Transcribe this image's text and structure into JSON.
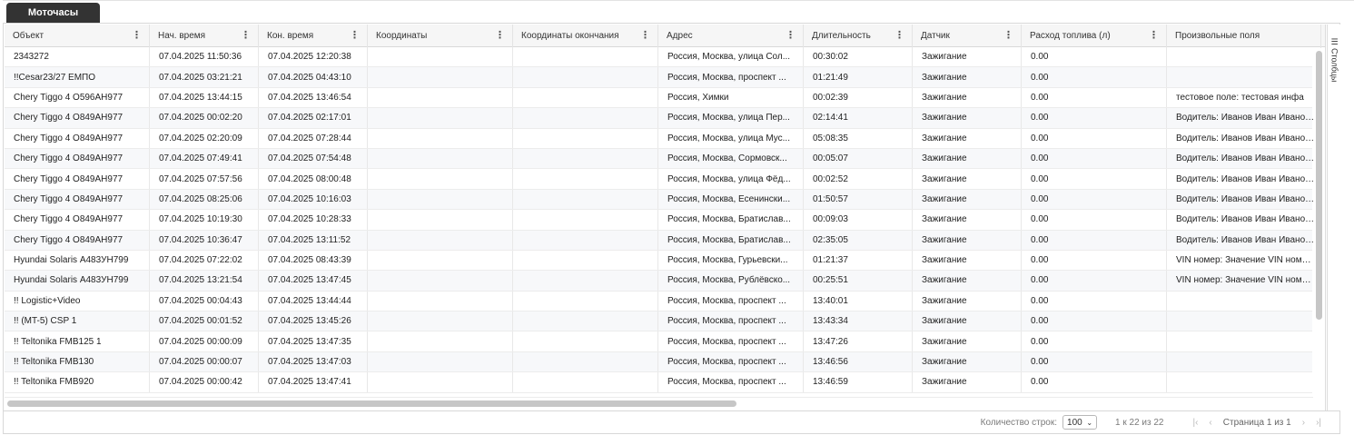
{
  "tab": {
    "label": "Моточасы"
  },
  "columns": [
    {
      "label": "Объект",
      "menu": true
    },
    {
      "label": "Нач. время",
      "menu": true
    },
    {
      "label": "Кон. время",
      "menu": true
    },
    {
      "label": "Координаты",
      "menu": true
    },
    {
      "label": "Координаты окончания",
      "menu": true
    },
    {
      "label": "Адрес",
      "menu": true
    },
    {
      "label": "Длительность",
      "menu": true
    },
    {
      "label": "Датчик",
      "menu": true
    },
    {
      "label": "Расход топлива (л)",
      "menu": true
    },
    {
      "label": "Произвольные поля",
      "menu": false
    }
  ],
  "rows": [
    [
      "2343272",
      "07.04.2025 11:50:36",
      "07.04.2025 12:20:38",
      "",
      "",
      "Россия, Москва, улица Сол...",
      "00:30:02",
      "Зажигание",
      "0.00",
      ""
    ],
    [
      "!!Cesar23/27 ЕМПО",
      "07.04.2025 03:21:21",
      "07.04.2025 04:43:10",
      "",
      "",
      "Россия, Москва, проспект ...",
      "01:21:49",
      "Зажигание",
      "0.00",
      ""
    ],
    [
      "Chery Tiggo 4 О596АН977",
      "07.04.2025 13:44:15",
      "07.04.2025 13:46:54",
      "",
      "",
      "Россия, Химки",
      "00:02:39",
      "Зажигание",
      "0.00",
      "тестовое поле: тестовая инфа"
    ],
    [
      "Chery Tiggo 4 О849АН977",
      "07.04.2025 00:02:20",
      "07.04.2025 02:17:01",
      "",
      "",
      "Россия, Москва, улица Пер...",
      "02:14:41",
      "Зажигание",
      "0.00",
      "Водитель: Иванов Иван Иванович"
    ],
    [
      "Chery Tiggo 4 О849АН977",
      "07.04.2025 02:20:09",
      "07.04.2025 07:28:44",
      "",
      "",
      "Россия, Москва, улица Мус...",
      "05:08:35",
      "Зажигание",
      "0.00",
      "Водитель: Иванов Иван Иванович"
    ],
    [
      "Chery Tiggo 4 О849АН977",
      "07.04.2025 07:49:41",
      "07.04.2025 07:54:48",
      "",
      "",
      "Россия, Москва, Сормовск...",
      "00:05:07",
      "Зажигание",
      "0.00",
      "Водитель: Иванов Иван Иванович"
    ],
    [
      "Chery Tiggo 4 О849АН977",
      "07.04.2025 07:57:56",
      "07.04.2025 08:00:48",
      "",
      "",
      "Россия, Москва, улица Фёд...",
      "00:02:52",
      "Зажигание",
      "0.00",
      "Водитель: Иванов Иван Иванович"
    ],
    [
      "Chery Tiggo 4 О849АН977",
      "07.04.2025 08:25:06",
      "07.04.2025 10:16:03",
      "",
      "",
      "Россия, Москва, Есенински...",
      "01:50:57",
      "Зажигание",
      "0.00",
      "Водитель: Иванов Иван Иванович"
    ],
    [
      "Chery Tiggo 4 О849АН977",
      "07.04.2025 10:19:30",
      "07.04.2025 10:28:33",
      "",
      "",
      "Россия, Москва, Братислав...",
      "00:09:03",
      "Зажигание",
      "0.00",
      "Водитель: Иванов Иван Иванович"
    ],
    [
      "Chery Tiggo 4 О849АН977",
      "07.04.2025 10:36:47",
      "07.04.2025 13:11:52",
      "",
      "",
      "Россия, Москва, Братислав...",
      "02:35:05",
      "Зажигание",
      "0.00",
      "Водитель: Иванов Иван Иванович"
    ],
    [
      "Hyundai Solaris А483УН799",
      "07.04.2025 07:22:02",
      "07.04.2025 08:43:39",
      "",
      "",
      "Россия, Москва, Гурьевски...",
      "01:21:37",
      "Зажигание",
      "0.00",
      "VIN номер: Значение VIN номера"
    ],
    [
      "Hyundai Solaris А483УН799",
      "07.04.2025 13:21:54",
      "07.04.2025 13:47:45",
      "",
      "",
      "Россия, Москва, Рублёвско...",
      "00:25:51",
      "Зажигание",
      "0.00",
      "VIN номер: Значение VIN номера"
    ],
    [
      "!! Logistic+Video",
      "07.04.2025 00:04:43",
      "07.04.2025 13:44:44",
      "",
      "",
      "Россия, Москва, проспект ...",
      "13:40:01",
      "Зажигание",
      "0.00",
      ""
    ],
    [
      "!! (MT-5) CSP 1",
      "07.04.2025 00:01:52",
      "07.04.2025 13:45:26",
      "",
      "",
      "Россия, Москва, проспект ...",
      "13:43:34",
      "Зажигание",
      "0.00",
      ""
    ],
    [
      "!! Teltonika FMB125 1",
      "07.04.2025 00:00:09",
      "07.04.2025 13:47:35",
      "",
      "",
      "Россия, Москва, проспект ...",
      "13:47:26",
      "Зажигание",
      "0.00",
      ""
    ],
    [
      "!! Teltonika FMB130",
      "07.04.2025 00:00:07",
      "07.04.2025 13:47:03",
      "",
      "",
      "Россия, Москва, проспект ...",
      "13:46:56",
      "Зажигание",
      "0.00",
      ""
    ],
    [
      "!! Teltonika FMB920",
      "07.04.2025 00:00:42",
      "07.04.2025 13:47:41",
      "",
      "",
      "Россия, Москва, проспект ...",
      "13:46:59",
      "Зажигание",
      "0.00",
      ""
    ]
  ],
  "side_panel": {
    "columns_label": "Столбцы",
    "icon": "columns-icon"
  },
  "footer": {
    "rows_count_label": "Количество строк:",
    "rows_per_page": "100",
    "range_text": "1 к 22 из 22",
    "page_text": "Страница 1 из 1"
  }
}
